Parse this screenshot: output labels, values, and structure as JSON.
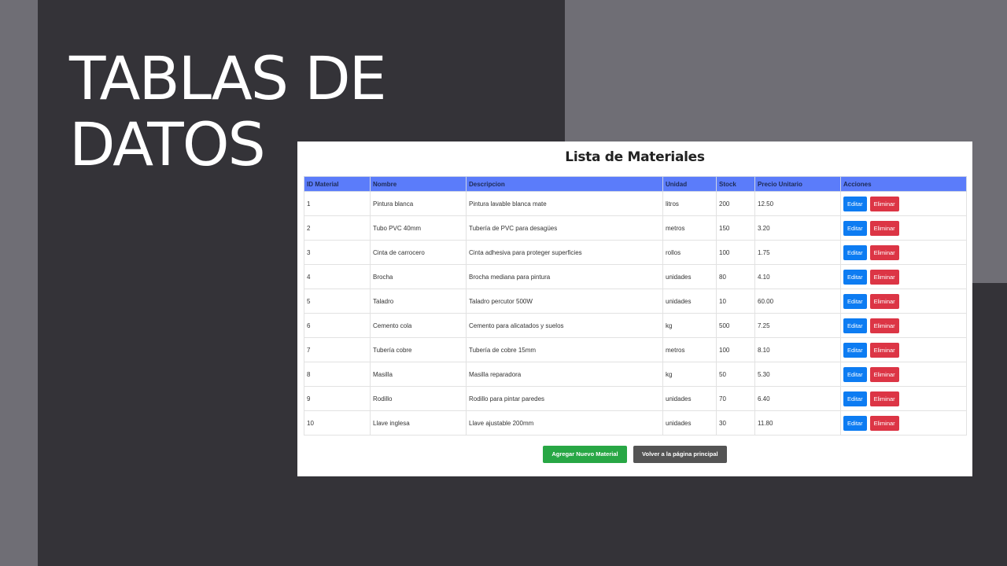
{
  "slide": {
    "title_line1": "TABLAS DE",
    "title_line2": "DATOS"
  },
  "page": {
    "title": "Lista de Materiales",
    "columns": [
      "ID Material",
      "Nombre",
      "Descripcion",
      "Unidad",
      "Stock",
      "Precio Unitario",
      "Acciones"
    ],
    "rows": [
      {
        "id": "1",
        "nombre": "Pintura blanca",
        "descripcion": "Pintura lavable blanca mate",
        "unidad": "litros",
        "stock": "200",
        "precio": "12.50"
      },
      {
        "id": "2",
        "nombre": "Tubo PVC 40mm",
        "descripcion": "Tubería de PVC para desagües",
        "unidad": "metros",
        "stock": "150",
        "precio": "3.20"
      },
      {
        "id": "3",
        "nombre": "Cinta de carrocero",
        "descripcion": "Cinta adhesiva para proteger superficies",
        "unidad": "rollos",
        "stock": "100",
        "precio": "1.75"
      },
      {
        "id": "4",
        "nombre": "Brocha",
        "descripcion": "Brocha mediana para pintura",
        "unidad": "unidades",
        "stock": "80",
        "precio": "4.10"
      },
      {
        "id": "5",
        "nombre": "Taladro",
        "descripcion": "Taladro percutor 500W",
        "unidad": "unidades",
        "stock": "10",
        "precio": "60.00"
      },
      {
        "id": "6",
        "nombre": "Cemento cola",
        "descripcion": "Cemento para alicatados y suelos",
        "unidad": "kg",
        "stock": "500",
        "precio": "7.25"
      },
      {
        "id": "7",
        "nombre": "Tubería cobre",
        "descripcion": "Tubería de cobre 15mm",
        "unidad": "metros",
        "stock": "100",
        "precio": "8.10"
      },
      {
        "id": "8",
        "nombre": "Masilla",
        "descripcion": "Masilla reparadora",
        "unidad": "kg",
        "stock": "50",
        "precio": "5.30"
      },
      {
        "id": "9",
        "nombre": "Rodillo",
        "descripcion": "Rodillo para pintar paredes",
        "unidad": "unidades",
        "stock": "70",
        "precio": "6.40"
      },
      {
        "id": "10",
        "nombre": "Llave inglesa",
        "descripcion": "Llave ajustable 200mm",
        "unidad": "unidades",
        "stock": "30",
        "precio": "11.80"
      }
    ],
    "edit_label": "Editar",
    "delete_label": "Eliminar",
    "add_label": "Agregar Nuevo Material",
    "back_label": "Volver a la página principal"
  },
  "colors": {
    "header_bg": "#5b7cfa",
    "edit": "#0d7cf2",
    "delete": "#dc3545",
    "add": "#28a745",
    "back": "#545454"
  }
}
